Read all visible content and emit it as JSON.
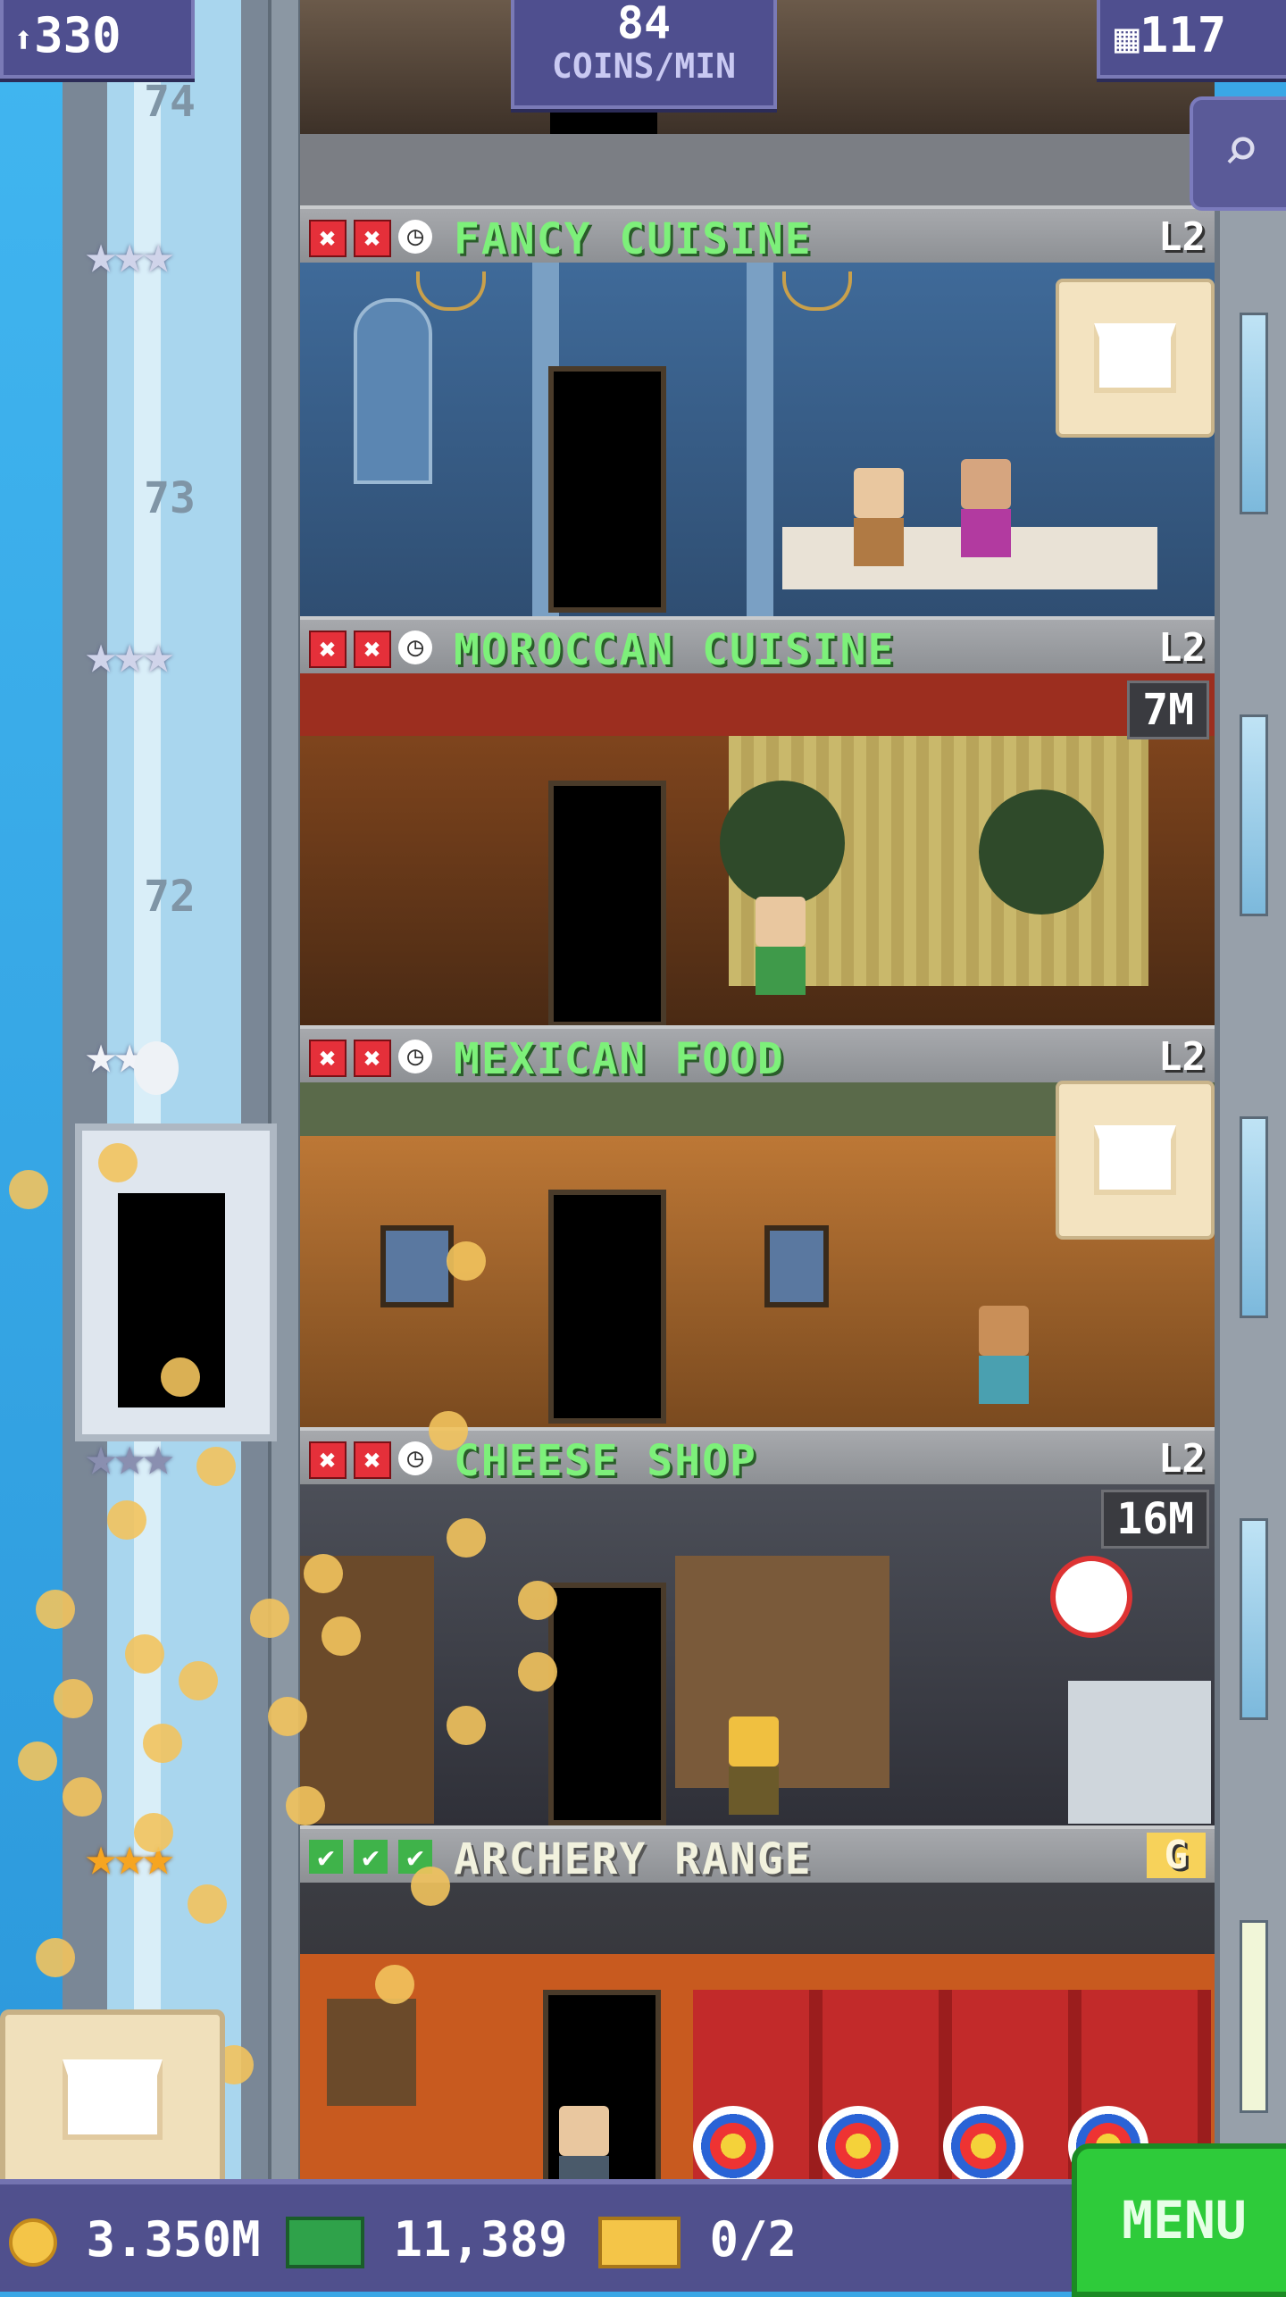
{
  "hud": {
    "population": "330",
    "coins_per_min_value": "84",
    "coins_per_min_label": "COINS/MIN",
    "floors": "117"
  },
  "bottom": {
    "coins": "3.350M",
    "bux": "11,389",
    "tickets": "0/2",
    "menu_label": "MENU"
  },
  "shaft_numbers": {
    "n74": "74",
    "n73": "73",
    "n72": "72"
  },
  "floors": [
    {
      "name": "FANCY CUISINE",
      "level": "L2",
      "timer": "",
      "status": [
        "x",
        "x",
        "clock"
      ],
      "stars": "★★★"
    },
    {
      "name": "MOROCCAN CUISINE",
      "level": "L2",
      "timer": "7M",
      "status": [
        "x",
        "x",
        "clock"
      ],
      "stars": "★★★"
    },
    {
      "name": "MEXICAN FOOD",
      "level": "L2",
      "timer": "",
      "status": [
        "x",
        "x",
        "clock"
      ],
      "stars": "★★★"
    },
    {
      "name": "CHEESE SHOP",
      "level": "L2",
      "timer": "16M",
      "status": [
        "x",
        "x",
        "clock"
      ],
      "stars": "★★★"
    },
    {
      "name": "ARCHERY RANGE",
      "level": "G",
      "timer": "",
      "status": [
        "check",
        "check",
        "check"
      ],
      "stars": "★★★"
    }
  ],
  "icons": {
    "population": "person-icon",
    "floors": "building-icon",
    "search": "magnifier-icon",
    "stock": "box-icon",
    "coin": "coin-icon",
    "bux": "cash-icon",
    "ticket": "ticket-icon"
  },
  "colors": {
    "floor_name": "#7df07a",
    "hud_bg": "#4f4f8f",
    "menu_green": "#2ecb3a"
  }
}
